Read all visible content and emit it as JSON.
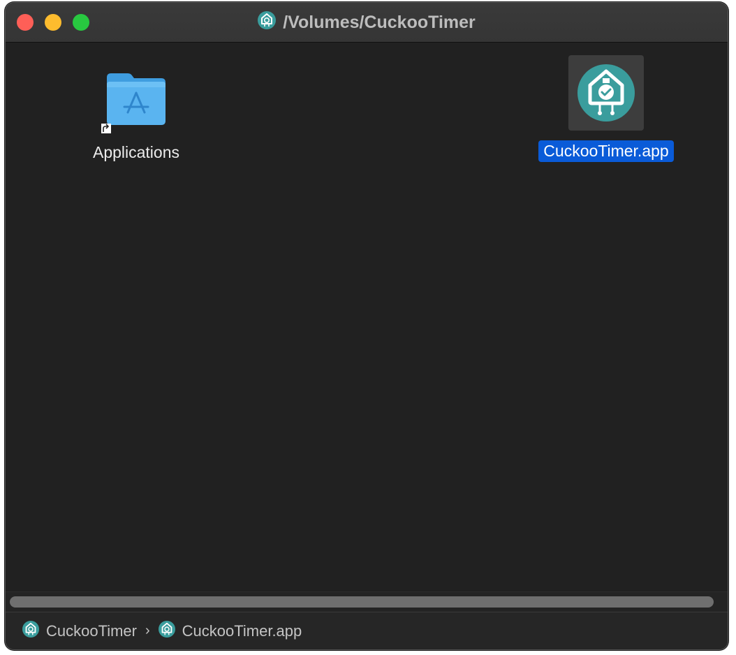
{
  "window": {
    "title": "/Volumes/CuckooTimer",
    "title_icon": "cuckoo-clock-icon"
  },
  "traffic_lights": {
    "close_color": "#fe5f57",
    "minimize_color": "#febc2e",
    "zoom_color": "#28c840"
  },
  "items": [
    {
      "label": "Applications",
      "icon": "applications-folder-alias-icon",
      "selected": false
    },
    {
      "label": "CuckooTimer.app",
      "icon": "cuckoo-timer-app-icon",
      "selected": true
    }
  ],
  "pathbar": {
    "crumbs": [
      {
        "label": "CuckooTimer",
        "icon": "cuckoo-clock-icon"
      },
      {
        "label": "CuckooTimer.app",
        "icon": "cuckoo-clock-icon"
      }
    ],
    "separator": "›"
  },
  "colors": {
    "selection": "#0a5bd8",
    "folder": "#5ab4f0",
    "app_icon": "#3a9d9d"
  }
}
